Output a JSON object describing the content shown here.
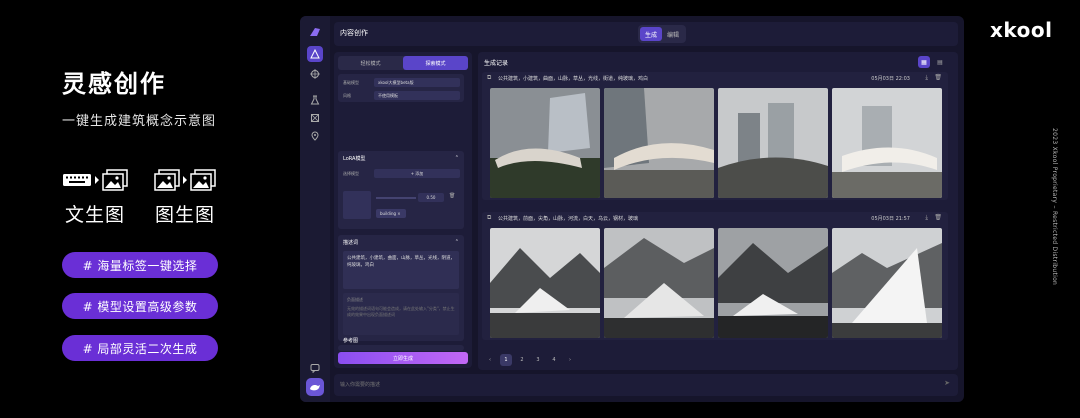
{
  "promo": {
    "title": "灵感创作",
    "subtitle": "一键生成建筑概念示意图",
    "modes": [
      {
        "label": "文生图"
      },
      {
        "label": "图生图"
      }
    ],
    "features": [
      "# 海量标签一键选择",
      "# 模型设置高级参数",
      "# 局部灵活二次生成"
    ]
  },
  "app": {
    "title": "内容创作",
    "top_tabs": [
      "生成",
      "编辑"
    ],
    "active_top_tab": "生成",
    "panel_tabs": [
      "轻松模式",
      "探索模式"
    ],
    "active_panel_tab": "探索模式",
    "model_card": {
      "model_label": "基础模型",
      "model_value": "xkool大模型beta版",
      "style_label": "风格",
      "style_value": "不使用模板"
    },
    "lora_card": {
      "title": "LoRA模型",
      "select_label": "选择模型",
      "add_label": "+ 添加",
      "weight": "0.50",
      "tag": "building ×"
    },
    "prompt_card": {
      "title": "描述词",
      "text": "公共建筑，小建筑，曲面，山脉，草丛，光线，阴道，纯玻璃，鸡白",
      "hint_title": "负面描述",
      "hint_text": "无效的描述词语句可能会造成，请在此处输入\"分类\"，禁止生成的效果中出现负面描述词"
    },
    "reference_title": "参考图",
    "generate_label": "立即生成",
    "results": {
      "title": "生成记录",
      "groups": [
        {
          "tags": "公共建筑，小建筑，曲面，山脉，草丛，光线，街道，纯玻璃，鸡白",
          "time": "05月03日 22:03"
        },
        {
          "tags": "公共建筑，前面，尖角，山脉，河流，白天，乌云，钢材，玻璃",
          "time": "05月03日 21:57"
        }
      ],
      "pages": [
        "‹",
        "1",
        "2",
        "3",
        "4",
        "›"
      ]
    },
    "prompt_placeholder": "输入你需要的描述"
  },
  "brand": "xkool",
  "side_note": "2023 Xkool Proprietary – Restricted Distribution",
  "colors": {
    "accent": "#6a2fd6",
    "app_bg": "#16152b",
    "panel_bg": "#1d1c38"
  }
}
